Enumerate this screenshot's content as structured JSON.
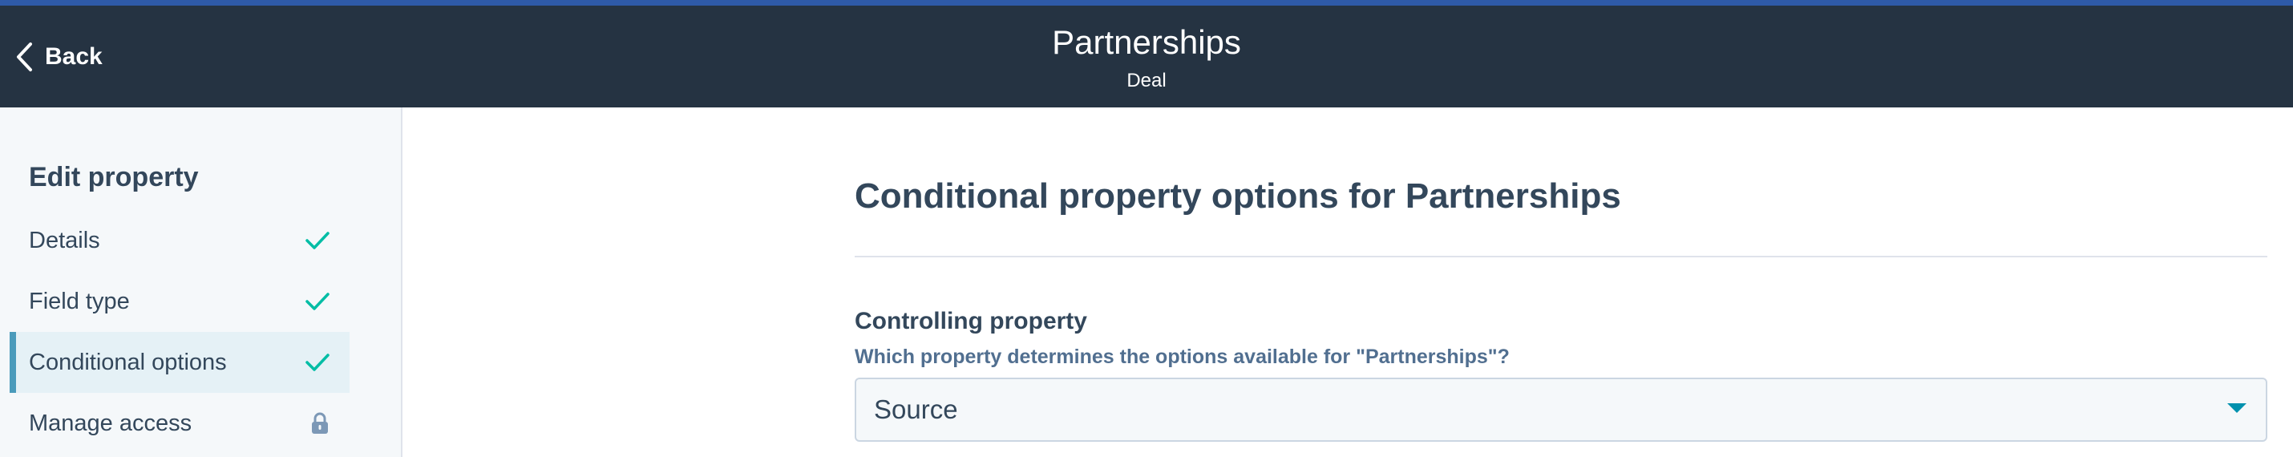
{
  "header": {
    "back_label": "Back",
    "title": "Partnerships",
    "subtitle": "Deal"
  },
  "sidebar": {
    "heading": "Edit property",
    "items": [
      {
        "label": "Details",
        "icon": "check-icon",
        "state": "complete"
      },
      {
        "label": "Field type",
        "icon": "check-icon",
        "state": "complete"
      },
      {
        "label": "Conditional options",
        "icon": "check-icon",
        "state": "active"
      },
      {
        "label": "Manage access",
        "icon": "lock-icon",
        "state": "locked"
      }
    ]
  },
  "main": {
    "title": "Conditional property options for Partnerships",
    "controlling_property": {
      "label": "Controlling property",
      "help": "Which property determines the options available for \"Partnerships\"?",
      "value": "Source"
    }
  },
  "colors": {
    "accent_bar": "#2e5aa8",
    "header_bg": "#253342",
    "check": "#00bda5",
    "active_item_bg": "#e5f1f6",
    "active_item_border": "#4a9bbb"
  }
}
